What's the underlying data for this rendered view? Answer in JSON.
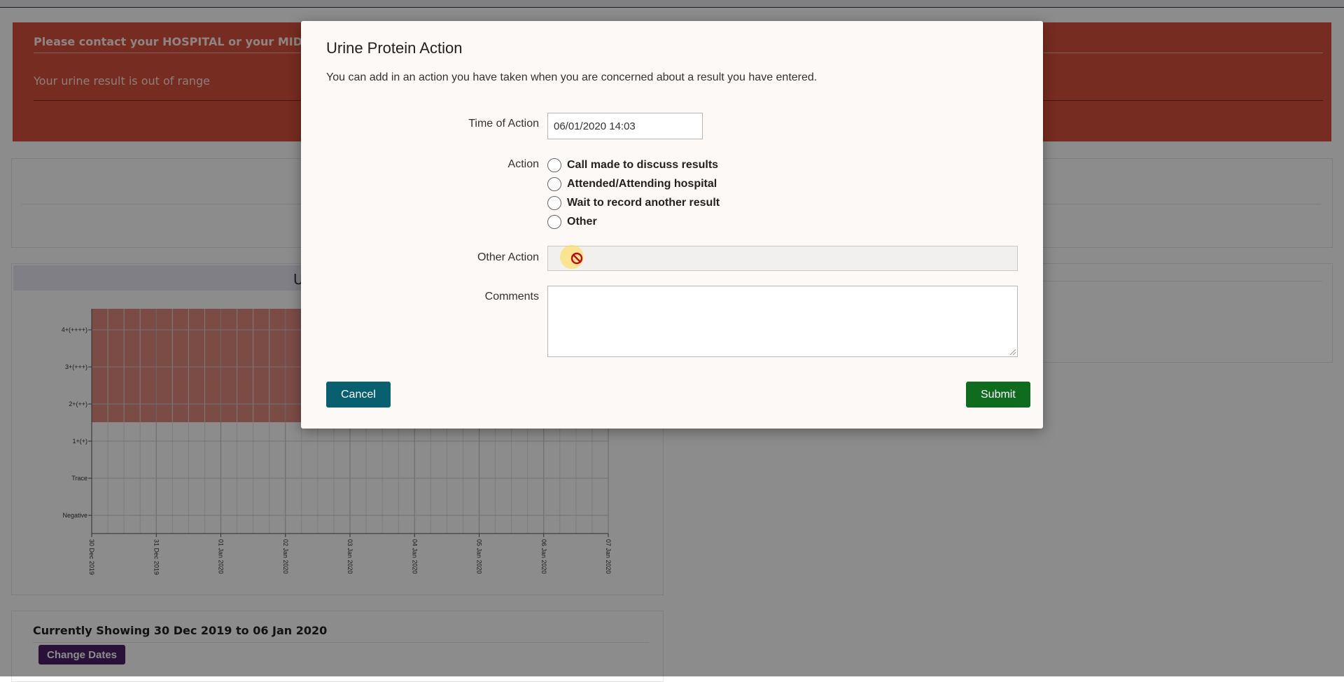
{
  "alert": {
    "title": "Please contact your HOSPITAL or your MIDWIFE imm",
    "message": "Your urine result is out of range"
  },
  "background_chart": {
    "title": "U"
  },
  "date_range": {
    "text": "Currently Showing 30 Dec 2019 to 06 Jan 2020",
    "change_label": "Change Dates"
  },
  "modal": {
    "title": "Urine Protein Action",
    "description": "You can add in an action you have taken when you are concerned about a result you have entered.",
    "time_label": "Time of Action",
    "time_value": "06/01/2020 14:03",
    "action_label": "Action",
    "options": [
      "Call made to discuss results",
      "Attended/Attending hospital",
      "Wait to record another result",
      "Other"
    ],
    "other_label": "Other Action",
    "comments_label": "Comments",
    "cancel_label": "Cancel",
    "submit_label": "Submit"
  },
  "chart_data": {
    "type": "heatmap",
    "y_categories": [
      "Negative",
      "Trace",
      "1+(+)",
      "2+(++)",
      "3+(+++)",
      "4+(++++)"
    ],
    "x_ticks": [
      "30 Dec 2019",
      "31 Dec 2019",
      "01 Jan 2020",
      "02 Jan 2020",
      "03 Jan 2020",
      "04 Jan 2020",
      "05 Jan 2020",
      "06 Jan 2020",
      "07 Jan 2020"
    ],
    "alert_band": [
      "2+(++)",
      "4+(++++)"
    ],
    "colors": {
      "alert_band": "#e08a80",
      "grid": "#cfcfcf"
    }
  }
}
